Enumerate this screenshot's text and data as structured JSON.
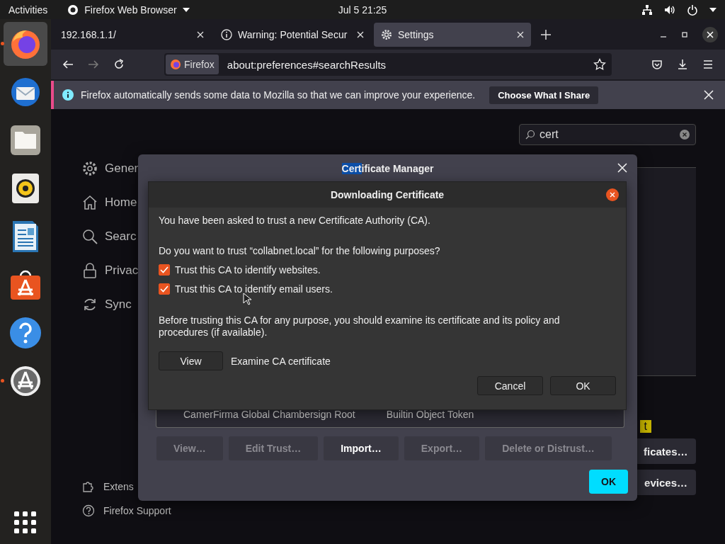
{
  "top_bar": {
    "activities": "Activities",
    "app_menu": "Firefox Web Browser",
    "clock": "Jul 5  21:25"
  },
  "dock": {
    "items": [
      {
        "kind": "firefox",
        "selected": true,
        "running": true
      },
      {
        "kind": "mail",
        "selected": false,
        "running": false
      },
      {
        "kind": "files",
        "selected": false,
        "running": false
      },
      {
        "kind": "speaker",
        "selected": false,
        "running": false
      },
      {
        "kind": "document",
        "selected": false,
        "running": false
      },
      {
        "kind": "store",
        "selected": false,
        "running": false
      },
      {
        "kind": "help",
        "selected": false,
        "running": false
      },
      {
        "kind": "updater",
        "selected": false,
        "running": true
      }
    ]
  },
  "tabs": [
    {
      "kind": "plain",
      "title": "192.168.1.1/",
      "selected": false
    },
    {
      "kind": "warning",
      "title": "Warning: Potential Secur",
      "selected": false
    },
    {
      "kind": "settings",
      "title": "Settings",
      "selected": true
    }
  ],
  "address_bar": {
    "identity": "Firefox",
    "url": "about:preferences#searchResults"
  },
  "notification": {
    "message": "Firefox automatically sends some data to Mozilla so that we can improve your experience.",
    "button": "Choose What I Share"
  },
  "search": {
    "value": "cert"
  },
  "sidebar": {
    "items": [
      {
        "kind": "gear",
        "label": "Gener"
      },
      {
        "kind": "home",
        "label": "Home"
      },
      {
        "kind": "search",
        "label": "Searc"
      },
      {
        "kind": "lock",
        "label": "Privac"
      },
      {
        "kind": "sync",
        "label": "Sync"
      }
    ],
    "footer": [
      {
        "kind": "puzzle",
        "label": "Extens"
      },
      {
        "kind": "help",
        "label": "Firefox Support"
      }
    ]
  },
  "side_panel": {
    "highlight": "t",
    "buttons": [
      "ficates…",
      "evices…"
    ]
  },
  "certificate_manager": {
    "title_highlight": "Cert",
    "title_rest": "ificate Manager",
    "row": [
      "CamerFirma Global Chambersign Root",
      "Builtin Object Token"
    ],
    "buttons": [
      {
        "label": "View…",
        "disabled": true
      },
      {
        "label": "Edit Trust…",
        "disabled": true
      },
      {
        "label": "Import…",
        "disabled": false
      },
      {
        "label": "Export…",
        "disabled": true
      },
      {
        "label": "Delete or Distrust…",
        "disabled": true
      }
    ],
    "ok": "OK"
  },
  "download_dialog": {
    "title": "Downloading Certificate",
    "intro": "You have been asked to trust a new Certificate Authority (CA).",
    "question": "Do you want to trust “collabnet.local” for the following purposes?",
    "options": [
      {
        "label": "Trust this CA to identify websites.",
        "checked": true
      },
      {
        "label": "Trust this CA to identify email users.",
        "checked": true
      }
    ],
    "warning": "Before trusting this CA for any purpose, you should examine its certificate and its policy and procedures (if available).",
    "view_button": "View",
    "view_caption": "Examine CA certificate",
    "buttons": [
      "Cancel",
      "OK"
    ]
  }
}
